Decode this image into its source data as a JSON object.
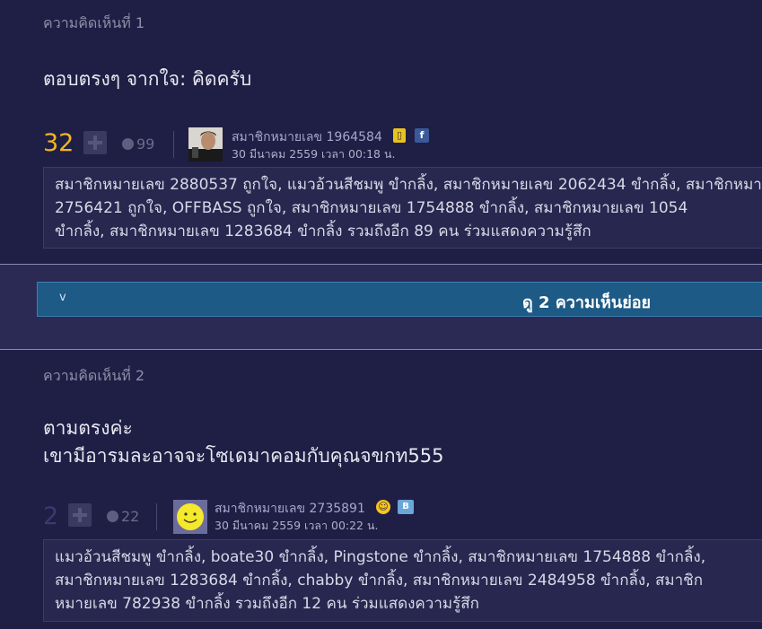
{
  "comments": [
    {
      "number_label": "ความคิดเห็นที่ 1",
      "body": [
        "ตอบตรงๆ จากใจ: คิดครับ"
      ],
      "score": "32",
      "emotion_count": "99",
      "username": "สมาชิกหมายเลข 1964584",
      "timestamp": "30 มีนาคม 2559 เวลา 00:18 น.",
      "emotions_text": [
        "สมาชิกหมายเลข 2880537 ถูกใจ, แมวอ้วนสีชมพู ขำกลิ้ง, สมาชิกหมายเลข 2062434 ขำกลิ้ง, สมาชิกหมายเลข",
        "2756421 ถูกใจ, OFFBASS ถูกใจ, สมาชิกหมายเลข 1754888 ขำกลิ้ง, สมาชิกหมายเลข 1054",
        "ขำกลิ้ง, สมาชิกหมายเลข 1283684 ขำกลิ้ง รวมถึงอีก 89 คน ร่วมแสดงความรู้สึก"
      ]
    },
    {
      "number_label": "ความคิดเห็นที่ 2",
      "body": [
        "ตามตรงค่ะ",
        "เขามีอารมละอาจจะโซเดมาคอมกับคุณจขกท555"
      ],
      "score": "2",
      "emotion_count": "22",
      "username": "สมาชิกหมายเลข 2735891",
      "timestamp": "30 มีนาคม 2559 เวลา 00:22 น.",
      "emotions_text": [
        "แมวอ้วนสีชมพู ขำกลิ้ง, boate30 ขำกลิ้ง, Pingstone ขำกลิ้ง, สมาชิกหมายเลข 1754888 ขำกลิ้ง,",
        "สมาชิกหมายเลข 1283684 ขำกลิ้ง, chabby ขำกลิ้ง, สมาชิกหมายเลข 2484958 ขำกลิ้ง, สมาชิก",
        "หมายเลข 782938 ขำกลิ้ง รวมถึงอีก 12 คน ร่วมแสดงความรู้สึก"
      ]
    }
  ],
  "subcomment_button": {
    "label": "ดู 2 ความเห็นย่อย",
    "chevron": "v"
  },
  "icons": {
    "comment1_badges": [
      "mobile-icon",
      "facebook-icon"
    ],
    "comment2_badges": [
      "laughing-emoji-icon",
      "blogger-icon"
    ]
  },
  "colors": {
    "background": "#1f1e45",
    "band": "#2b2a55",
    "score_high": "#f2b624",
    "score_low": "#3a3970",
    "button": "#1d5a86",
    "username": "#a7a7cc"
  }
}
